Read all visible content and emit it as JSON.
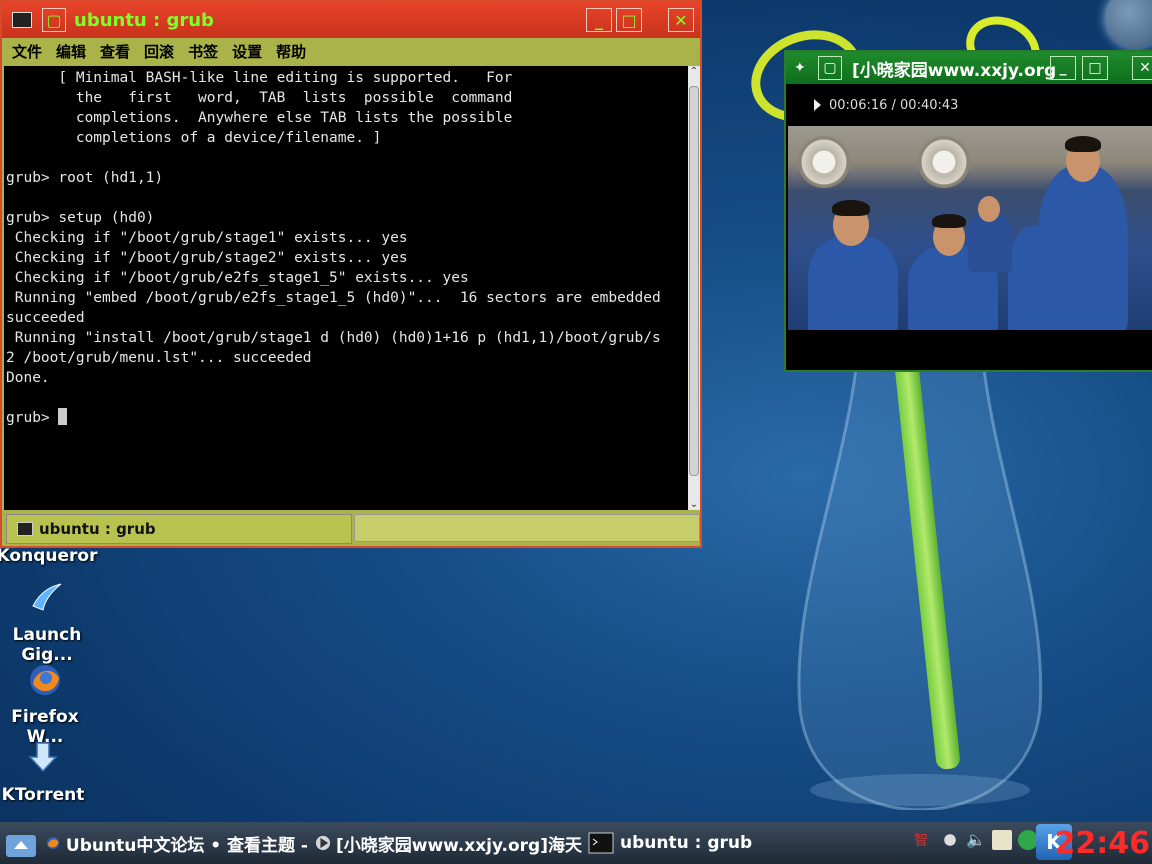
{
  "terminal_window": {
    "title": "ubuntu : grub",
    "menu": [
      "文件",
      "编辑",
      "查看",
      "回滚",
      "书签",
      "设置",
      "帮助"
    ],
    "lines": [
      "      [ Minimal BASH-like line editing is supported.   For",
      "        the   first   word,  TAB  lists  possible  command",
      "        completions.  Anywhere else TAB lists the possible",
      "        completions of a device/filename. ]",
      "",
      "grub> root (hd1,1)",
      "",
      "grub> setup (hd0)",
      " Checking if \"/boot/grub/stage1\" exists... yes",
      " Checking if \"/boot/grub/stage2\" exists... yes",
      " Checking if \"/boot/grub/e2fs_stage1_5\" exists... yes",
      " Running \"embed /boot/grub/e2fs_stage1_5 (hd0)\"...  16 sectors are embedded",
      "succeeded",
      " Running \"install /boot/grub/stage1 d (hd0) (hd0)1+16 p (hd1,1)/boot/grub/s",
      "2 /boot/grub/menu.lst\"... succeeded",
      "Done.",
      ""
    ],
    "prompt": "grub> ",
    "tab_label": "ubuntu : grub"
  },
  "video_window": {
    "title": "[小晓家园www.xxjy.org",
    "time": "00:06:16 / 00:40:43"
  },
  "desktop_icons": [
    {
      "label": "Konqueror"
    },
    {
      "label": "Launch Gig..."
    },
    {
      "label": "Firefox W..."
    },
    {
      "label": "KTorrent"
    }
  ],
  "taskbar": {
    "items": [
      {
        "label": "Ubuntu中文论坛 • 查看主题 -"
      },
      {
        "label": "[小晓家园www.xxjy.org]海天"
      },
      {
        "label": "ubuntu : grub"
      }
    ],
    "clock": "22:46"
  },
  "colors": {
    "terminal_titlebar": "#d8402a",
    "terminal_frame": "#a9b349",
    "video_titlebar": "#1a8a2a",
    "title_text": "#7dff2a",
    "clock": "#ff2a2a"
  }
}
